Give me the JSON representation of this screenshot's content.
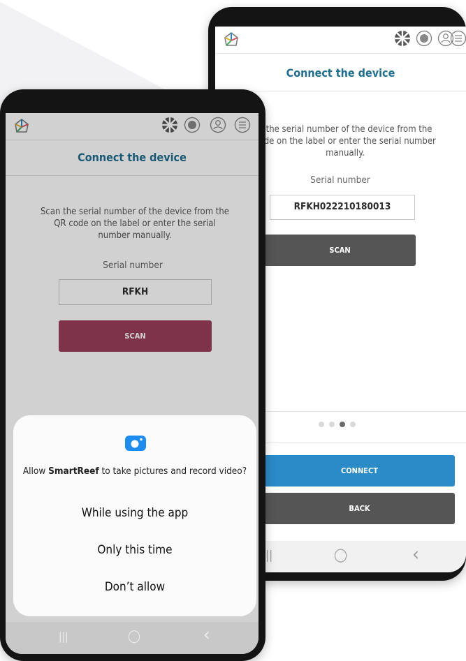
{
  "front": {
    "header": {
      "icons": [
        "app-logo",
        "language-flag-icon",
        "globe-icon",
        "user-icon",
        "menu-icon"
      ]
    },
    "title": "Connect the device",
    "instruction": "Scan the serial number of the device from the QR code on the label or enter the serial number manually.",
    "serial_label": "Serial number",
    "serial_value": "RFKH",
    "scan_button": "SCAN",
    "colors": {
      "title": "#1f6d8f",
      "scan_button": "#9b3f5c"
    },
    "permission_dialog": {
      "icon": "camera-icon",
      "message_prefix": "Allow ",
      "app_name": "SmartReef",
      "message_suffix": " to take pictures and record video?",
      "options": [
        "While using the app",
        "Only this time",
        "Don’t allow"
      ]
    },
    "nav": {
      "recent": "|||",
      "home": "◯",
      "back": "‹"
    }
  },
  "back": {
    "title": "Connect the device",
    "instruction": "n the serial number of the device from the code on the label or enter the serial number manually.",
    "serial_label": "Serial number",
    "serial_value": "RFKH022210180013",
    "scan_button": "SCAN",
    "pager": {
      "count": 4,
      "active": 2
    },
    "connect_button": "CONNECT",
    "back_button": "BACK",
    "colors": {
      "connect_button": "#2b8ac8",
      "dark_button": "#555555"
    },
    "nav": {
      "recent": "||",
      "home": "◯",
      "back": "‹"
    }
  }
}
